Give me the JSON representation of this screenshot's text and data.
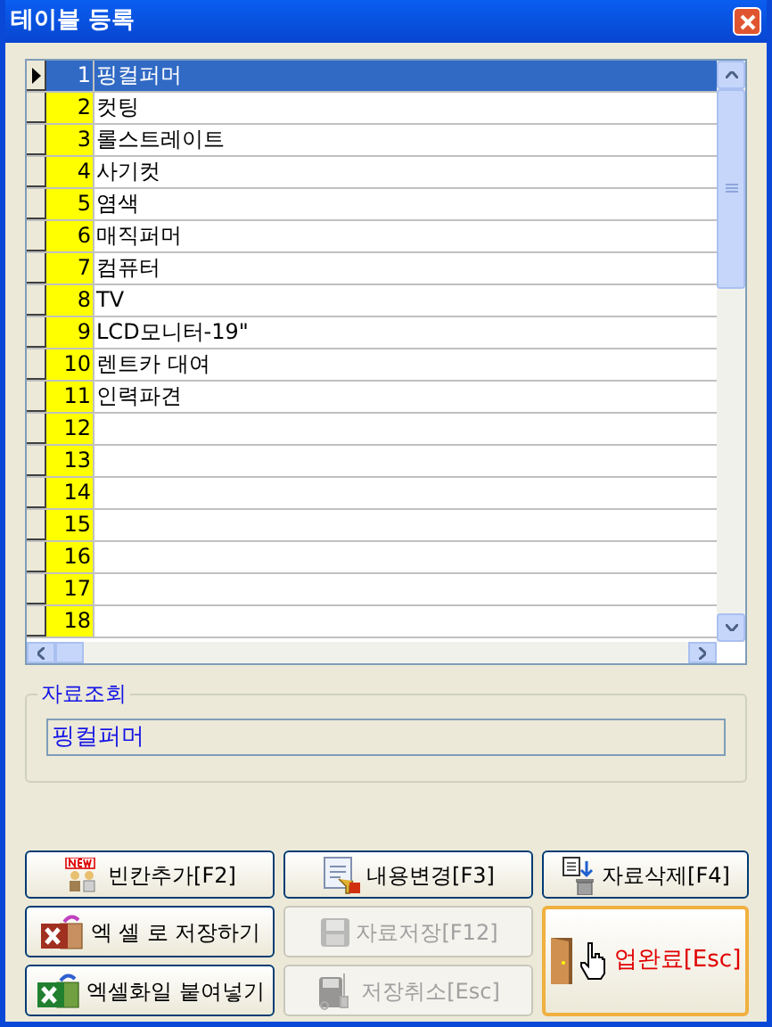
{
  "window": {
    "title": "테이블 등록"
  },
  "grid": {
    "rows": [
      {
        "number": "1",
        "text": "핑컬퍼머",
        "selected": true
      },
      {
        "number": "2",
        "text": "컷팅",
        "selected": false
      },
      {
        "number": "3",
        "text": "롤스트레이트",
        "selected": false
      },
      {
        "number": "4",
        "text": "사기컷",
        "selected": false
      },
      {
        "number": "5",
        "text": "염색",
        "selected": false
      },
      {
        "number": "6",
        "text": "매직퍼머",
        "selected": false
      },
      {
        "number": "7",
        "text": "컴퓨터",
        "selected": false
      },
      {
        "number": "8",
        "text": "TV",
        "selected": false
      },
      {
        "number": "9",
        "text": "LCD모니터-19\"",
        "selected": false
      },
      {
        "number": "10",
        "text": "렌트카 대여",
        "selected": false
      },
      {
        "number": "11",
        "text": "인력파견",
        "selected": false
      },
      {
        "number": "12",
        "text": "",
        "selected": false
      },
      {
        "number": "13",
        "text": "",
        "selected": false
      },
      {
        "number": "14",
        "text": "",
        "selected": false
      },
      {
        "number": "15",
        "text": "",
        "selected": false
      },
      {
        "number": "16",
        "text": "",
        "selected": false
      },
      {
        "number": "17",
        "text": "",
        "selected": false
      },
      {
        "number": "18",
        "text": "",
        "selected": false
      }
    ]
  },
  "lookup": {
    "title": "자료조회",
    "value": "핑컬퍼머"
  },
  "buttons": [
    {
      "kind": "action",
      "label": "빈칸추가[F2]",
      "disabled": false
    },
    {
      "kind": "action",
      "label": "내용변경[F3]",
      "disabled": false
    },
    {
      "kind": "action",
      "label": "자료삭제[F4]",
      "disabled": false
    },
    {
      "kind": "action",
      "label": "엑 셀 로 저장하기",
      "disabled": false
    },
    {
      "kind": "action",
      "label": "자료저장[F12]",
      "disabled": true
    },
    {
      "kind": "action",
      "label": "엑셀화일 붙여넣기",
      "disabled": false
    },
    {
      "kind": "action",
      "label": "저장취소[Esc]",
      "disabled": true
    },
    {
      "kind": "finish",
      "label": "업완료[Esc]",
      "disabled": false
    }
  ]
}
